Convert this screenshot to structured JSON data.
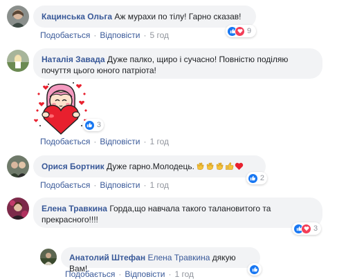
{
  "comments": [
    {
      "author": "Кацинська Ольга",
      "text": "Аж мурахи по тілу! Гарно сказав!",
      "actions": {
        "like": "Подобається",
        "reply": "Відповісти",
        "time": "5 год"
      },
      "reactions": {
        "count": "9",
        "types": [
          "like",
          "love"
        ]
      }
    },
    {
      "author": "Наталія Завада",
      "text": "Дуже палко, щиро і сучасно! Повністю поділяю почуття цього юного патріота!",
      "sticker": "girl-holding-heart-sticker",
      "actions": {
        "like": "Подобається",
        "reply": "Відповісти",
        "time": "1 год"
      },
      "reactions": {
        "count": "3",
        "types": [
          "like"
        ]
      }
    },
    {
      "author": "Орися Бортник",
      "text": "Дуже гарно.Молодець.",
      "emoji": [
        "clapping-hands",
        "clapping-hands",
        "clapping-hands",
        "thumbs-up",
        "red-heart"
      ],
      "actions": {
        "like": "Подобається",
        "reply": "Відповісти",
        "time": "1 год"
      },
      "reactions": {
        "count": "2",
        "types": [
          "like"
        ]
      }
    },
    {
      "author": "Елена Травкина",
      "text": "Горда,що навчала такого талановитого та прекрасного!!!!",
      "actions": {
        "like": "Подобається",
        "reply": "Відповісти",
        "time": "1 год"
      },
      "reactions": {
        "count": "3",
        "types": [
          "like",
          "love"
        ]
      }
    }
  ],
  "reply": {
    "author": "Анатолий Штефан",
    "mention": "Елена Травкина",
    "text": "дякую Вам!",
    "actions": {
      "like": "Подобається",
      "reply": "Відповісти",
      "time": "1 год"
    },
    "reactions": {
      "count": "",
      "types": [
        "like"
      ]
    }
  },
  "colors": {
    "link": "#385898",
    "bubble": "#f2f3f5",
    "like": "#1877f2",
    "love": "#f33e58",
    "meta": "#90949c"
  }
}
